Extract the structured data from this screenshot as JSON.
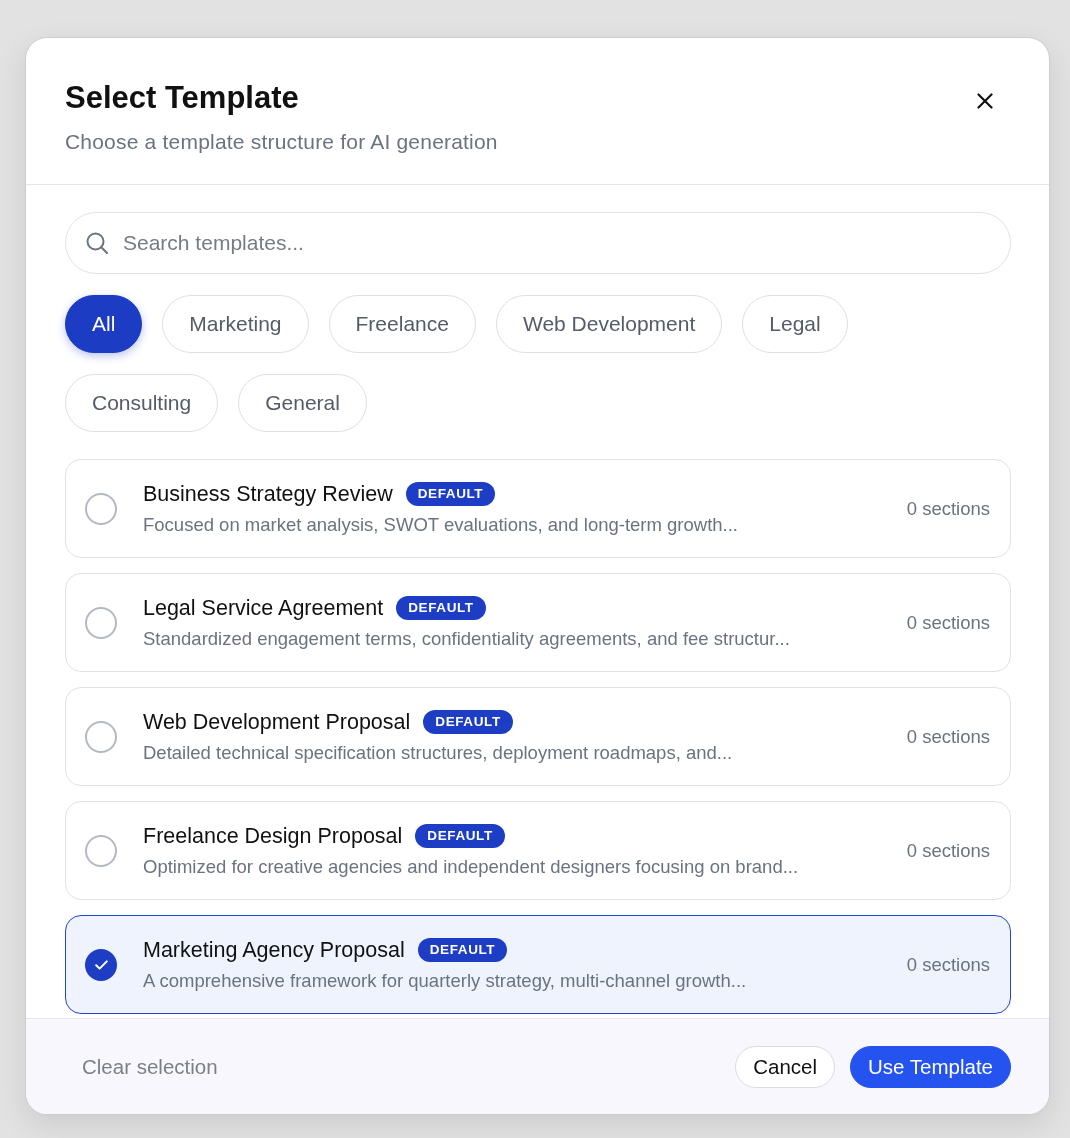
{
  "dialog": {
    "title": "Select Template",
    "subtitle": "Choose a template structure for AI generation"
  },
  "search": {
    "placeholder": "Search templates..."
  },
  "filters": [
    {
      "label": "All",
      "selected": true
    },
    {
      "label": "Marketing",
      "selected": false
    },
    {
      "label": "Freelance",
      "selected": false
    },
    {
      "label": "Web Development",
      "selected": false
    },
    {
      "label": "Legal",
      "selected": false
    },
    {
      "label": "Consulting",
      "selected": false
    },
    {
      "label": "General",
      "selected": false
    }
  ],
  "templates": [
    {
      "name": "Business Strategy Review",
      "badge": "DEFAULT",
      "description": "Focused on market analysis, SWOT evaluations, and long-term growth...",
      "sections": "0 sections",
      "selected": false
    },
    {
      "name": "Legal Service Agreement",
      "badge": "DEFAULT",
      "description": "Standardized engagement terms, confidentiality agreements, and fee structur...",
      "sections": "0 sections",
      "selected": false
    },
    {
      "name": "Web Development Proposal",
      "badge": "DEFAULT",
      "description": "Detailed technical specification structures, deployment roadmaps, and...",
      "sections": "0 sections",
      "selected": false
    },
    {
      "name": "Freelance Design Proposal",
      "badge": "DEFAULT",
      "description": "Optimized for creative agencies and independent designers focusing on brand...",
      "sections": "0 sections",
      "selected": false
    },
    {
      "name": "Marketing Agency Proposal",
      "badge": "DEFAULT",
      "description": "A comprehensive framework for quarterly strategy, multi-channel growth...",
      "sections": "0 sections",
      "selected": true
    }
  ],
  "footer": {
    "clear_label": "Clear selection",
    "buttons": [
      {
        "label": "Cancel",
        "kind": "secondary"
      },
      {
        "label": "Use Template",
        "kind": "primary"
      }
    ]
  }
}
